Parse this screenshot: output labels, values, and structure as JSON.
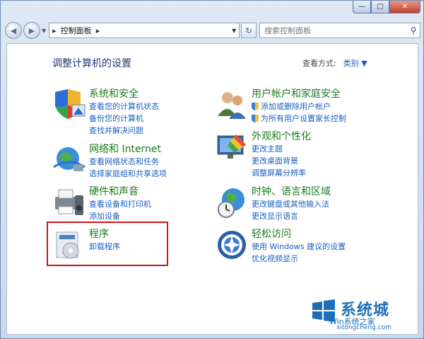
{
  "window": {
    "minimize": "—",
    "maximize": "□",
    "close": "✕"
  },
  "nav": {
    "back": "◀",
    "forward": "▶",
    "recent": "▼",
    "path_root_arrow": "▸",
    "path_item": "控制面板",
    "path_sep": "▸",
    "dropdown": "▼",
    "refresh": "↻",
    "search_placeholder": "搜索控制面板",
    "search_icon": "⚲"
  },
  "header": {
    "title": "调整计算机的设置",
    "view_by_label": "查看方式:",
    "view_by_value": "类别 ▼"
  },
  "categories": [
    {
      "title": "系统和安全",
      "links": [
        "查看您的计算机状态",
        "备份您的计算机",
        "查找并解决问题"
      ],
      "icon": "system-security-icon"
    },
    {
      "title": "网络和 Internet",
      "links": [
        "查看网络状态和任务",
        "选择家庭组和共享选项"
      ],
      "icon": "network-icon"
    },
    {
      "title": "硬件和声音",
      "links": [
        "查看设备和打印机",
        "添加设备"
      ],
      "icon": "hardware-sound-icon"
    },
    {
      "title": "程序",
      "links": [
        "卸载程序"
      ],
      "icon": "programs-icon"
    },
    {
      "title": "用户帐户和家庭安全",
      "links": [
        "添加或删除用户帐户",
        "为所有用户设置家长控制"
      ],
      "icon": "user-accounts-icon"
    },
    {
      "title": "外观和个性化",
      "links": [
        "更改主题",
        "更改桌面背景",
        "调整屏幕分辨率"
      ],
      "icon": "appearance-icon"
    },
    {
      "title": "时钟、语言和区域",
      "links": [
        "更改键盘或其他输入法",
        "更改显示语言"
      ],
      "icon": "clock-language-icon"
    },
    {
      "title": "轻松访问",
      "links": [
        "使用 Windows 建议的设置",
        "优化视频显示"
      ],
      "icon": "ease-of-access-icon"
    }
  ],
  "watermark": {
    "big": "系统城",
    "mid": "Win系统之家",
    "url": "xitongcheng.com"
  },
  "colors": {
    "highlight": "#d2141a",
    "category_title": "#1e7a1e",
    "link": "#1a5fc2"
  }
}
